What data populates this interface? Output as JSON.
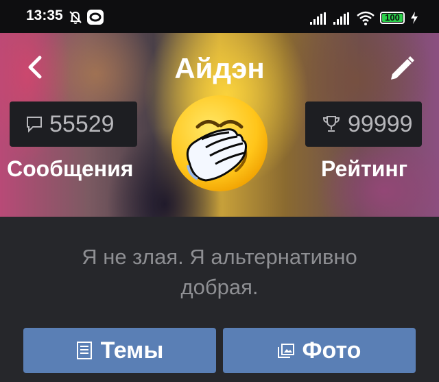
{
  "status_bar": {
    "time": "13:35",
    "battery": "100",
    "icons": [
      "bell-off-icon",
      "app-notification-icon",
      "signal-icon",
      "signal-icon",
      "wifi-icon",
      "battery-icon",
      "charging-icon"
    ]
  },
  "header": {
    "title": "Айдэн",
    "back_icon": "chevron-left-icon",
    "edit_icon": "pencil-icon"
  },
  "stats": {
    "messages": {
      "value": "55529",
      "label": "Сообщения",
      "icon": "speech-bubble-icon"
    },
    "rating": {
      "value": "99999",
      "label": "Рейтинг",
      "icon": "trophy-icon"
    }
  },
  "avatar": {
    "icon": "facepalm-emoji"
  },
  "profile": {
    "status": "Я не злая. Я альтернативно добрая."
  },
  "buttons": {
    "topics": {
      "label": "Темы",
      "icon": "document-icon"
    },
    "photos": {
      "label": "Фото",
      "icon": "photo-icon"
    }
  },
  "colors": {
    "background": "#26272b",
    "button": "#5a7fb5",
    "stat_box": "#1d1e22",
    "status_text": "#8e8f93"
  }
}
